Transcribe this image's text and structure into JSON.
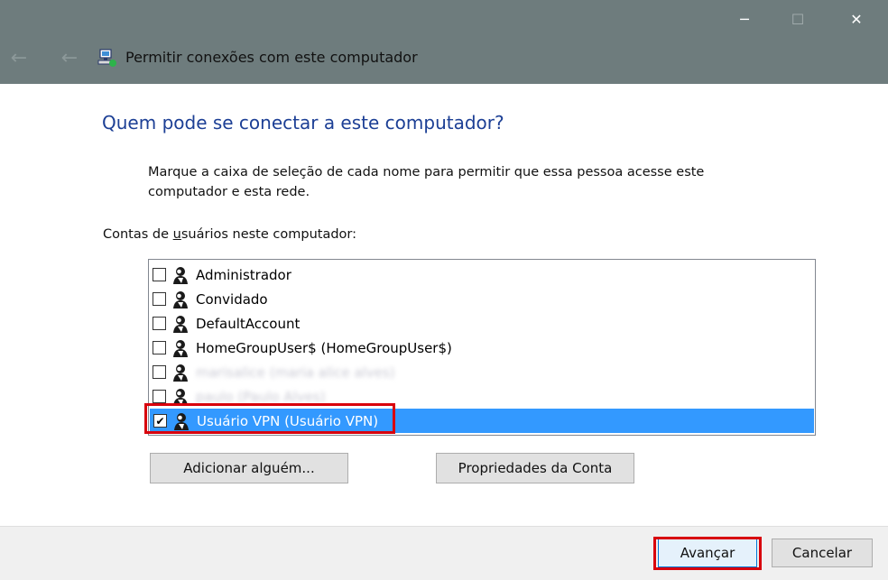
{
  "window": {
    "title": "Permitir conexões com este computador",
    "controls": {
      "minimize": "─",
      "maximize": "☐",
      "close": "✕"
    },
    "nav": {
      "back": "←",
      "forward": "←"
    }
  },
  "main": {
    "heading": "Quem pode se conectar a este computador?",
    "instructions": "Marque a caixa de seleção de cada nome para permitir que essa pessoa acesse este computador e esta rede.",
    "accounts_label_pre": "Contas de ",
    "accounts_label_underlined": "u",
    "accounts_label_post": "suários neste computador:"
  },
  "accounts": [
    {
      "label": "Administrador",
      "checked": false,
      "selected": false,
      "blurred": false
    },
    {
      "label": "Convidado",
      "checked": false,
      "selected": false,
      "blurred": false
    },
    {
      "label": "DefaultAccount",
      "checked": false,
      "selected": false,
      "blurred": false
    },
    {
      "label": "HomeGroupUser$ (HomeGroupUser$)",
      "checked": false,
      "selected": false,
      "blurred": false
    },
    {
      "label": "marisalice (maria alice alves)",
      "checked": false,
      "selected": false,
      "blurred": true
    },
    {
      "label": "paulo (Paulo Alves)",
      "checked": false,
      "selected": false,
      "blurred": true
    },
    {
      "label": "Usuário VPN (Usuário VPN)",
      "checked": true,
      "selected": true,
      "blurred": false
    }
  ],
  "buttons": {
    "add": "Adicionar alguém...",
    "properties": "Propriedades da Conta",
    "next": "Avançar",
    "cancel": "Cancelar"
  },
  "colors": {
    "titlebar": "#6e7c7d",
    "heading": "#1c3f95",
    "selection": "#3399ff",
    "highlight": "#d8000c"
  },
  "icons": {
    "title": "network-connection-icon",
    "user": "user-account-icon",
    "check": "✔"
  }
}
